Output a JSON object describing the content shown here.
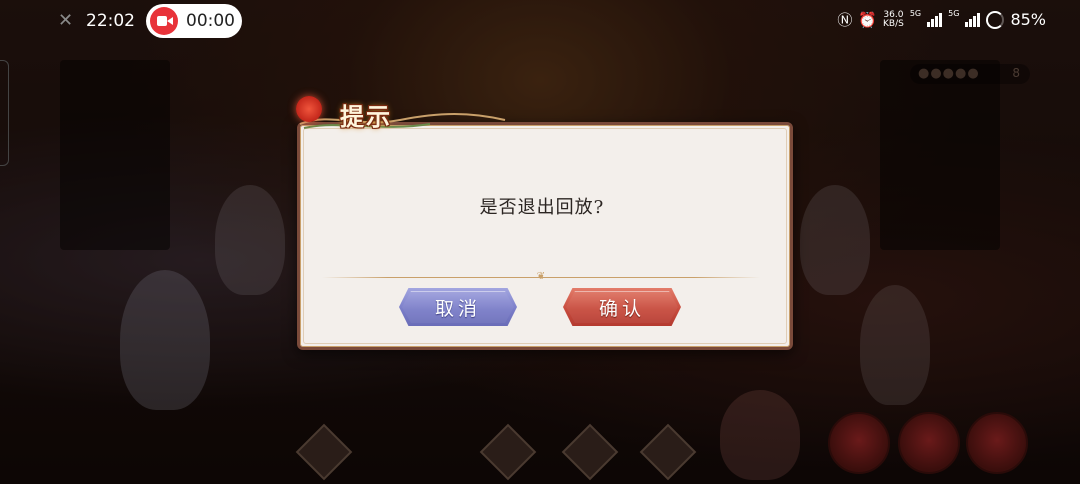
{
  "status_bar": {
    "time": "22:02",
    "recording_time": "00:00",
    "net_speed_top": "36.0",
    "net_speed_unit": "KB/S",
    "signal_1_label": "5G",
    "signal_2_label": "5G",
    "battery": "85%",
    "icons": [
      "close-icon",
      "record-camera-icon",
      "nfc-icon",
      "alarm-icon",
      "signal-icon",
      "battery-icon"
    ]
  },
  "hud": {
    "meter_value": "8"
  },
  "dialog": {
    "title": "提示",
    "message": "是否退出回放?",
    "cancel_label": "取消",
    "confirm_label": "确认"
  },
  "colors": {
    "cancel_button": "#7b7ec9",
    "confirm_button": "#c84c3e",
    "dialog_bg": "#f3efeb",
    "record_red": "#e8333a"
  }
}
